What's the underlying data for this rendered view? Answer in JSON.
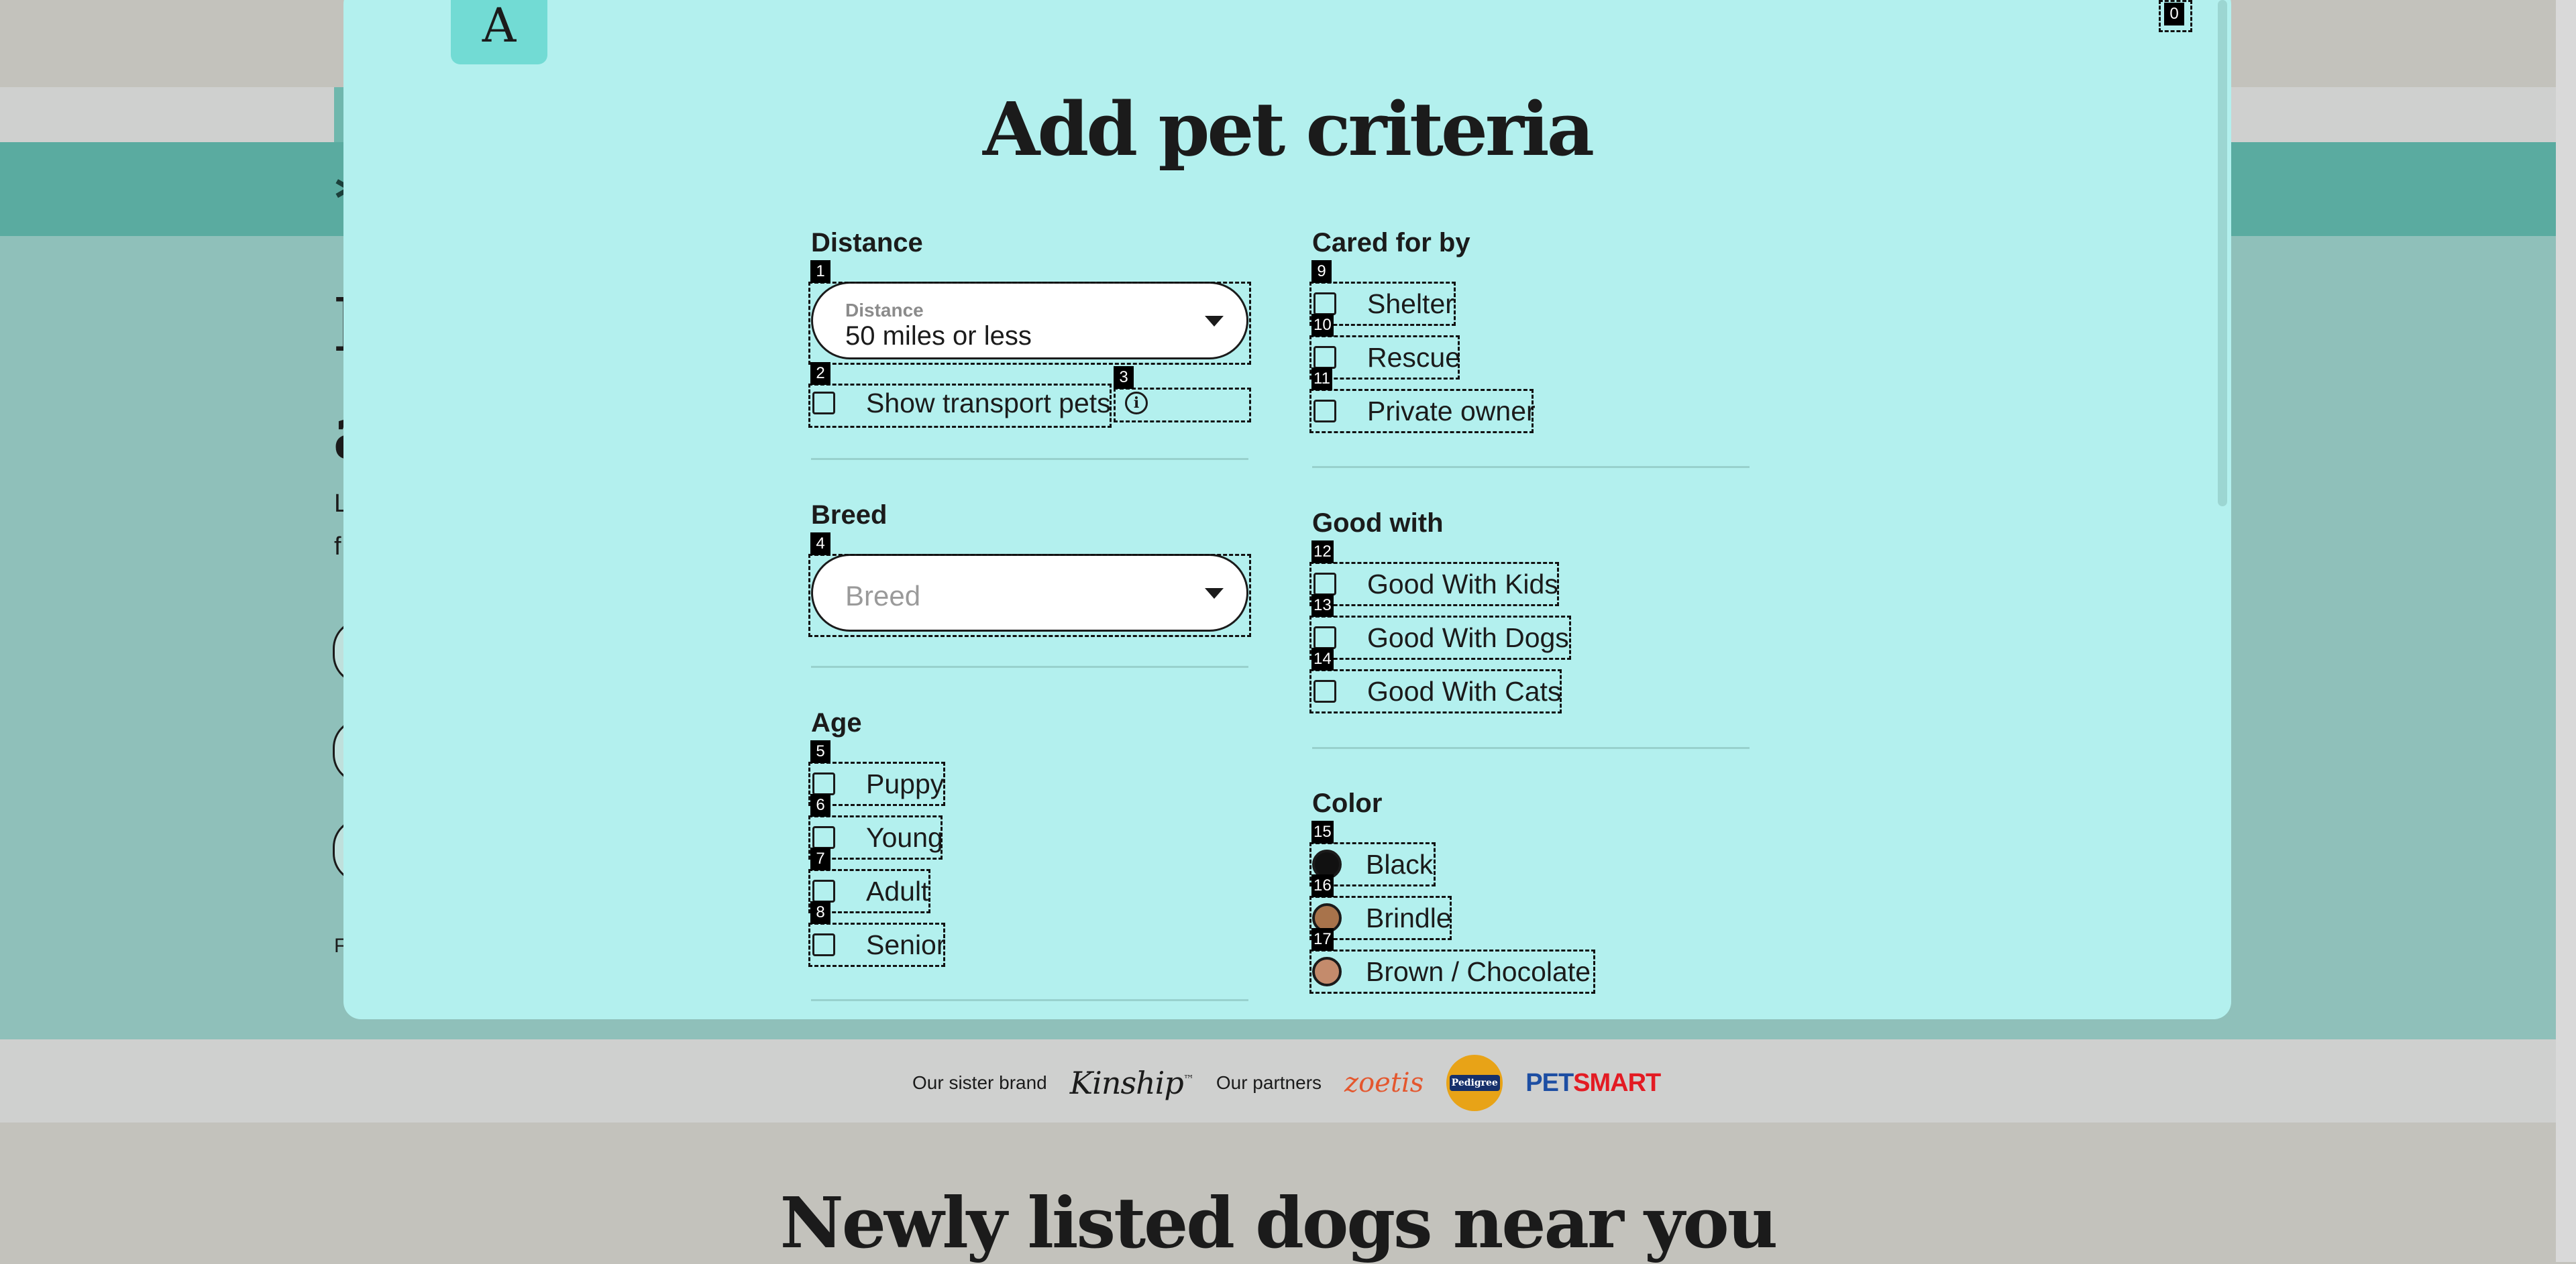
{
  "modal": {
    "logo_glyph": "A",
    "close_glyph": "✕",
    "title": "Add pet criteria"
  },
  "distance": {
    "section_label": "Distance",
    "select_label": "Distance",
    "select_value": "50 miles or less",
    "transport_label": "Show transport pets",
    "info_glyph": "i"
  },
  "breed": {
    "section_label": "Breed",
    "placeholder": "Breed"
  },
  "age": {
    "section_label": "Age",
    "options": [
      "Puppy",
      "Young",
      "Adult",
      "Senior"
    ]
  },
  "cared_for_by": {
    "section_label": "Cared for by",
    "options": [
      "Shelter",
      "Rescue",
      "Private owner"
    ]
  },
  "good_with": {
    "section_label": "Good with",
    "options": [
      "Good With Kids",
      "Good With Dogs",
      "Good With Cats"
    ]
  },
  "color": {
    "section_label": "Color",
    "options": [
      {
        "label": "Black",
        "swatch": "#111111"
      },
      {
        "label": "Brindle",
        "swatch": "#a8734b"
      },
      {
        "label": "Brown / Chocolate",
        "swatch": "#c48b6c"
      }
    ]
  },
  "overlay_tags": [
    "0",
    "1",
    "2",
    "3",
    "4",
    "5",
    "6",
    "7",
    "8",
    "9",
    "10",
    "11",
    "12",
    "13",
    "14",
    "15",
    "16",
    "17"
  ],
  "background": {
    "partners": {
      "sister_label": "Our sister brand",
      "sister_brand": "Kinship",
      "sister_tm": "™",
      "partners_label": "Our partners",
      "zoetis": "zoetis",
      "pedigree": "Pedigree",
      "petsmart_a": "PET",
      "petsmart_b": "SMART"
    },
    "newly_listed": "Newly listed dogs near you",
    "hero_letter_1": "L",
    "hero_letter_2": "a",
    "hero_small_1": "L",
    "hero_small_2": "f",
    "hero_small_3": "F"
  },
  "colors": {
    "modal_bg": "#b3f0ee",
    "nav_teal": "#5aaba0",
    "hero_teal": "#8fc0ba"
  }
}
